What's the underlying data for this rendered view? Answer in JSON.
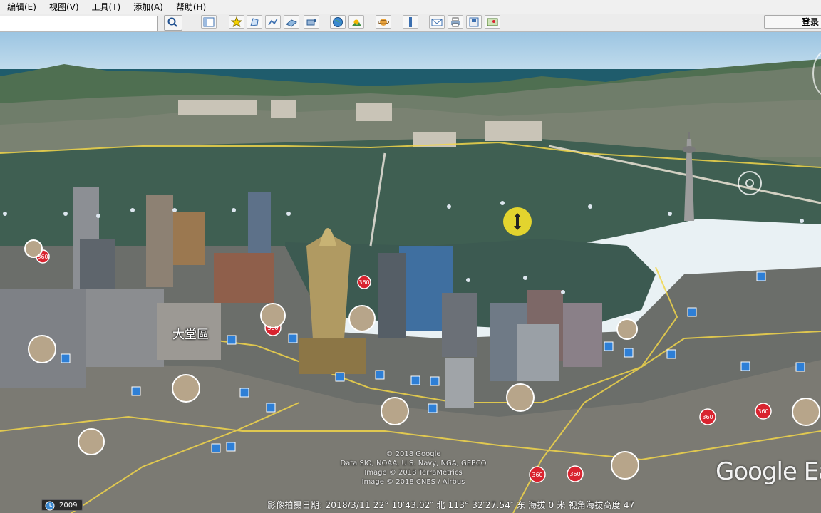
{
  "menu": {
    "items": [
      "编辑(E)",
      "视图(V)",
      "工具(T)",
      "添加(A)",
      "帮助(H)"
    ]
  },
  "toolbar": {
    "search_value": "",
    "login_label": "登录",
    "icons": [
      "search-icon",
      "sidebar-icon",
      "placemark-icon",
      "polygon-icon",
      "path-icon",
      "overlay-icon",
      "tour-icon",
      "earth-icon",
      "sunlight-icon",
      "planet-icon",
      "ruler-icon",
      "email-icon",
      "print-icon",
      "save-image-icon",
      "view-in-maps-icon"
    ]
  },
  "viewport": {
    "district_label": "大堂區",
    "poi_badge": "360",
    "copyright": [
      "© 2018 Google",
      "Data SIO, NOAA, U.S. Navy, NGA, GEBCO",
      "Image © 2018 TerraMetrics",
      "Image © 2018 CNES / Airbus"
    ],
    "logo": "Google Ea"
  },
  "status": {
    "year": "2009",
    "text": "影像拍摄日期: 2018/3/11   22° 10′43.02″ 北 113° 32′27.54″ 东 海拔      0 米   视角海拔高度   47"
  },
  "colors": {
    "road": "#f2d64a",
    "water": "#3f5f52",
    "badge_red": "#d9232f",
    "poi_blue": "#2e7fd6"
  }
}
